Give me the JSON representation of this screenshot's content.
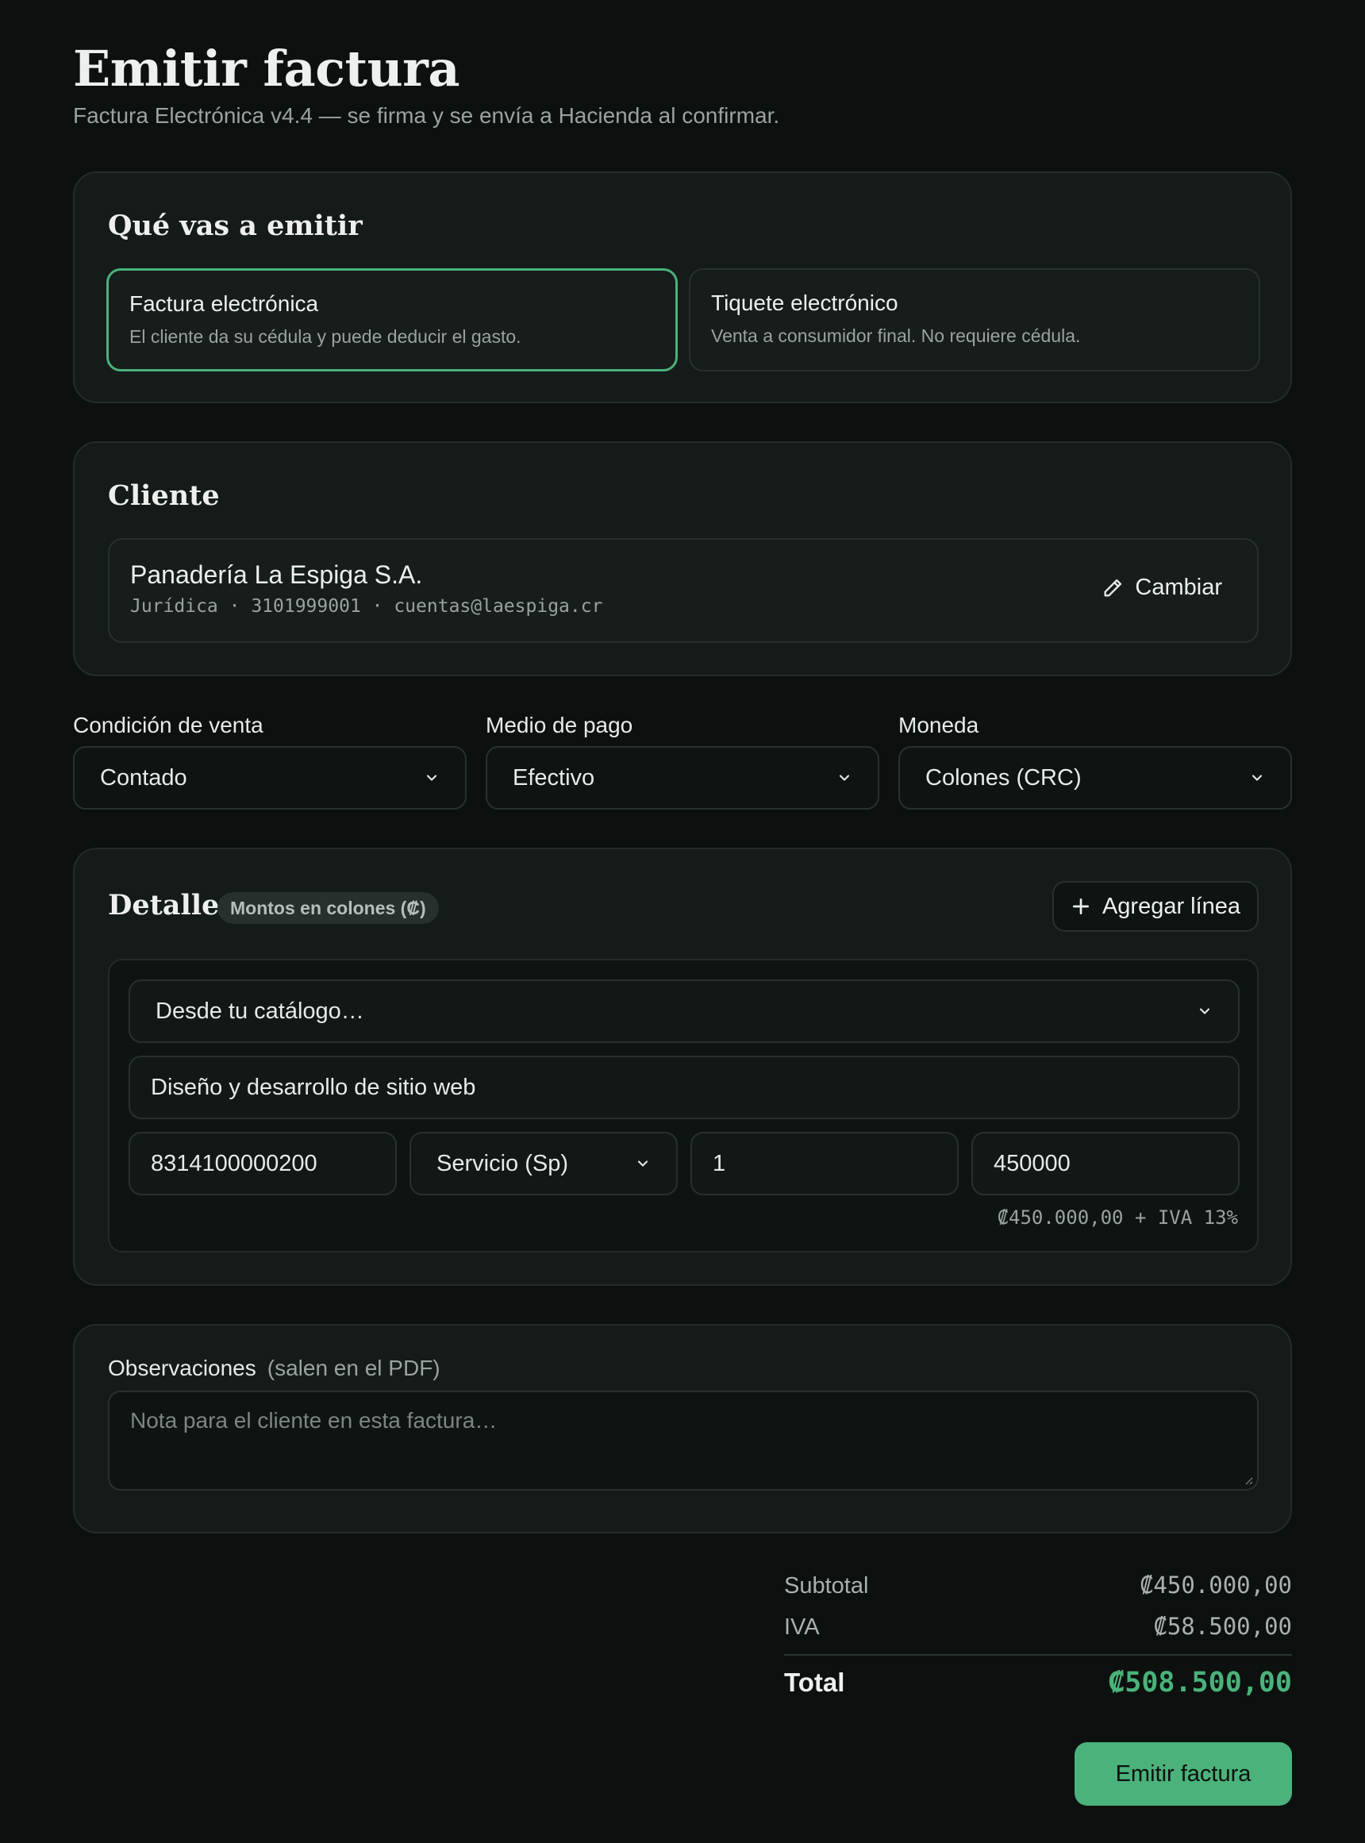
{
  "header": {
    "title": "Emitir factura",
    "subtitle": "Factura Electrónica v4.4 — se firma y se envía a Hacienda al confirmar."
  },
  "document_type": {
    "title": "Qué vas a emitir",
    "options": [
      {
        "label": "Factura electrónica",
        "description": "El cliente da su cédula y puede deducir el gasto.",
        "selected": true
      },
      {
        "label": "Tiquete electrónico",
        "description": "Venta a consumidor final. No requiere cédula.",
        "selected": false
      }
    ]
  },
  "client": {
    "title": "Cliente",
    "name": "Panadería La Espiga S.A.",
    "meta": "Jurídica · 3101999001 · cuentas@laespiga.cr",
    "change_label": "Cambiar"
  },
  "fields": {
    "sale_condition": {
      "label": "Condición de venta",
      "value": "Contado"
    },
    "payment_method": {
      "label": "Medio de pago",
      "value": "Efectivo"
    },
    "currency": {
      "label": "Moneda",
      "value": "Colones (CRC)"
    }
  },
  "detail": {
    "title": "Detalle",
    "badge": "Montos en colones (₡)",
    "add_line_label": "Agregar línea",
    "line": {
      "catalog_select": "Desde tu catálogo…",
      "description": "Diseño y desarrollo de sitio web",
      "cabys_code": "8314100000200",
      "unit": "Servicio (Sp)",
      "quantity": "1",
      "price": "450000",
      "summary": "₡450.000,00 + IVA 13%"
    }
  },
  "observations": {
    "label": "Observaciones",
    "hint": "(salen en el PDF)",
    "placeholder": "Nota para el cliente en esta factura…"
  },
  "totals": {
    "subtotal_label": "Subtotal",
    "subtotal_value": "₡450.000,00",
    "iva_label": "IVA",
    "iva_value": "₡58.500,00",
    "total_label": "Total",
    "total_value": "₡508.500,00"
  },
  "submit_label": "Emitir factura",
  "colors": {
    "accent": "#4ab27a",
    "background": "#0c110f",
    "card": "#141b18"
  }
}
